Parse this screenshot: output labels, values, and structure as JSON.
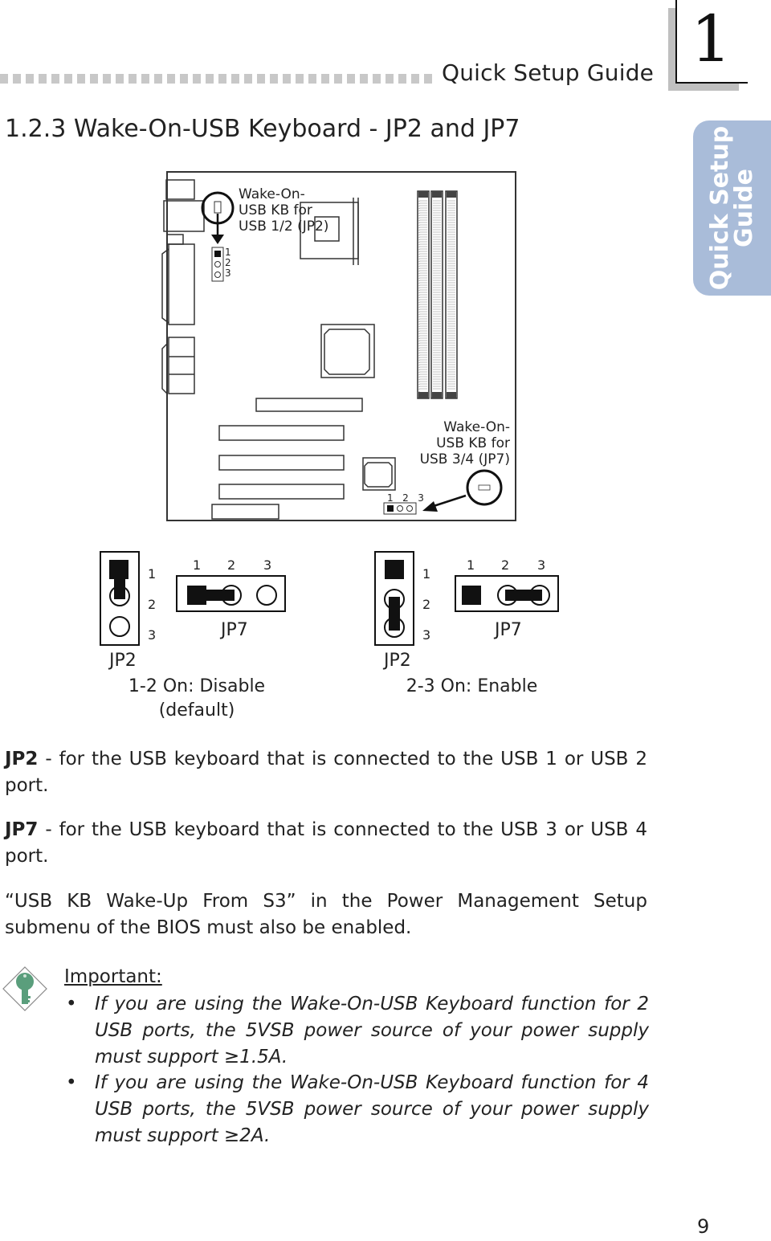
{
  "header": {
    "running_head": "Quick Setup Guide",
    "chapter_number": "1",
    "side_tab_line1": "Quick Setup",
    "side_tab_line2": "Guide"
  },
  "section": {
    "title": "1.2.3  Wake-On-USB Keyboard - JP2 and JP7"
  },
  "board_diagram": {
    "jp2_callout": [
      "Wake-On-",
      "USB KB for",
      "USB 1/2 (JP2)"
    ],
    "jp7_callout": [
      "Wake-On-",
      "USB KB for",
      "USB 3/4 (JP7)"
    ],
    "jp2_pins": [
      "1",
      "2",
      "3"
    ],
    "jp7_pins": [
      "1",
      "2",
      "3"
    ]
  },
  "configs": [
    {
      "jp2_label": "JP2",
      "jp7_label": "JP7",
      "pin_labels": [
        "1",
        "2",
        "3"
      ],
      "jumper": "1-2",
      "caption_line1": "1-2 On: Disable",
      "caption_line2": "(default)"
    },
    {
      "jp2_label": "JP2",
      "jp7_label": "JP7",
      "pin_labels": [
        "1",
        "2",
        "3"
      ],
      "jumper": "2-3",
      "caption_line1": "2-3 On: Enable",
      "caption_line2": ""
    }
  ],
  "body": {
    "p1_bold": "JP2",
    "p1_text": " - for the USB keyboard that is connected to the USB 1 or USB 2 port.",
    "p2_bold": "JP7",
    "p2_text": " - for the USB keyboard that is connected to the USB 3 or USB 4 port.",
    "p3_text": "“USB KB Wake-Up From S3” in the Power Management Setup submenu of the BIOS must also be enabled."
  },
  "important": {
    "icon": "key-icon",
    "heading": "Important:",
    "bullets": [
      "If you are using the Wake-On-USB Keyboard function for 2 USB ports, the 5VSB power source of your power supply must support ≥1.5A.",
      "If you are using the Wake-On-USB Keyboard function for 4 USB ports, the 5VSB power source of your power supply must support ≥2A."
    ],
    "bullet_char": "•"
  },
  "footer": {
    "page_number": "9"
  },
  "colors": {
    "side_tab": "#a9bcd9",
    "key_icon": "#5a9e7c",
    "dots": "#c8c8c8"
  }
}
